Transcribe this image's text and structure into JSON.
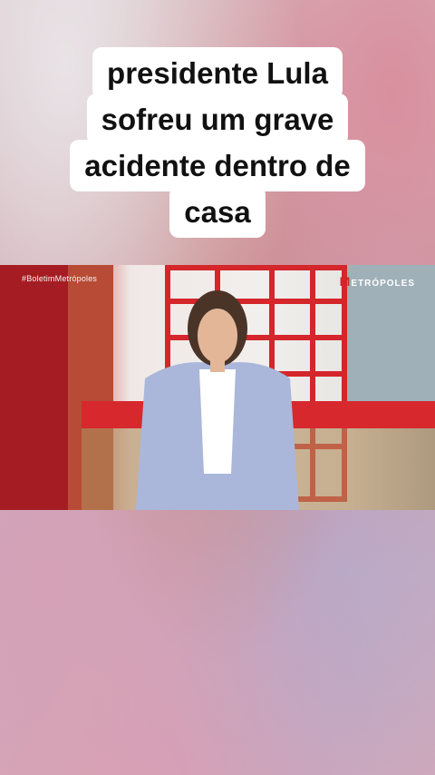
{
  "caption": {
    "lines": [
      "presidente Lula",
      "sofreu um grave",
      "acidente dentro de",
      "casa"
    ]
  },
  "video": {
    "hashtag": "#BoletimMetrópoles",
    "brand_initial": "M",
    "brand_rest": "ETRÓPOLES"
  },
  "colors": {
    "caption_background": "#ffffff",
    "caption_text": "#111111",
    "brand_red": "#d3242b"
  }
}
